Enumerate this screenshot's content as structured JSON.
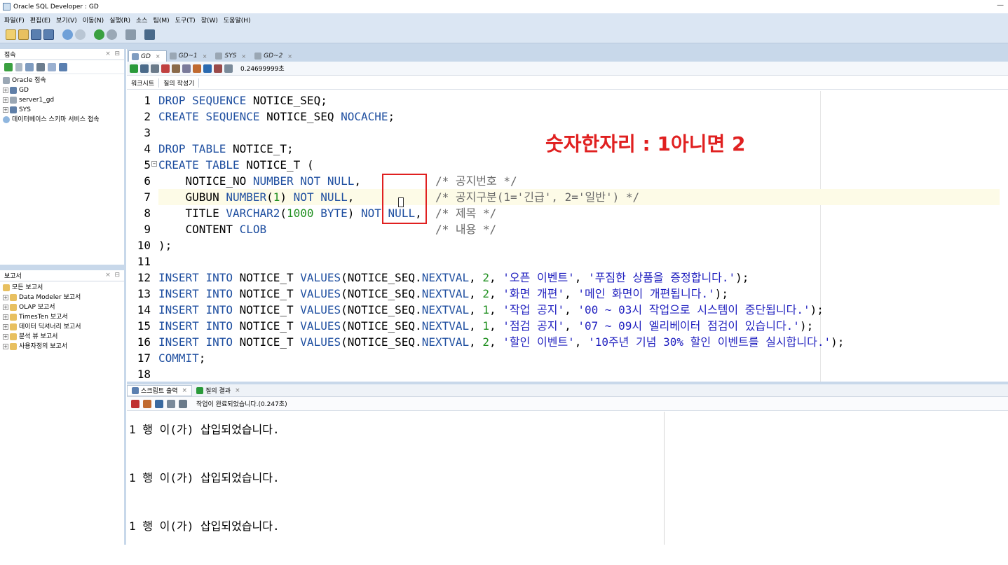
{
  "window": {
    "title": "Oracle SQL Developer : GD"
  },
  "menu": [
    "파일(F)",
    "편집(E)",
    "보기(V)",
    "이동(N)",
    "실행(R)",
    "소스",
    "팀(M)",
    "도구(T)",
    "창(W)",
    "도움말(H)"
  ],
  "connections_panel": {
    "title": "접속",
    "tree": [
      "Oracle 접속",
      "GD",
      "server1_gd",
      "SYS",
      "데이터베이스 스키마 서비스 접속"
    ]
  },
  "reports_panel": {
    "title": "보고서",
    "items": [
      "모든 보고서",
      "Data Modeler 보고서",
      "OLAP 보고서",
      "TimesTen 보고서",
      "데이터 딕셔너리 보고서",
      "분석 뷰 보고서",
      "사용자정의 보고서"
    ]
  },
  "editor_tabs": [
    "GD",
    "GD~1",
    "SYS",
    "GD~2"
  ],
  "editor_toolbar": {
    "timing": "0.24699999초"
  },
  "subtabs": [
    "워크시트",
    "질의 작성기"
  ],
  "annotation": "숫자한자리 : 1아니면 2",
  "code_lines": [
    "DROP SEQUENCE NOTICE_SEQ;",
    "CREATE SEQUENCE NOTICE_SEQ NOCACHE;",
    "",
    "DROP TABLE NOTICE_T;",
    "CREATE TABLE NOTICE_T (",
    "    NOTICE_NO NUMBER NOT NULL,           /* 공지번호 */",
    "    GUBUN NUMBER(1) NOT NULL,            /* 공지구분(1='긴급', 2='일반') */",
    "    TITLE VARCHAR2(1000 BYTE) NOT NULL,  /* 제목 */",
    "    CONTENT CLOB                         /* 내용 */",
    ");",
    "",
    "INSERT INTO NOTICE_T VALUES(NOTICE_SEQ.NEXTVAL, 2, '오픈 이벤트', '푸짐한 상품을 증정합니다.');",
    "INSERT INTO NOTICE_T VALUES(NOTICE_SEQ.NEXTVAL, 2, '화면 개편', '메인 화면이 개편됩니다.');",
    "INSERT INTO NOTICE_T VALUES(NOTICE_SEQ.NEXTVAL, 1, '작업 공지', '00 ~ 03시 작업으로 시스템이 중단됩니다.');",
    "INSERT INTO NOTICE_T VALUES(NOTICE_SEQ.NEXTVAL, 1, '점검 공지', '07 ~ 09시 엘리베이터 점검이 있습니다.');",
    "INSERT INTO NOTICE_T VALUES(NOTICE_SEQ.NEXTVAL, 2, '할인 이벤트', '10주년 기념 30% 할인 이벤트를 실시합니다.');",
    "COMMIT;",
    ""
  ],
  "output_tabs": [
    "스크립트 출력",
    "질의 결과"
  ],
  "output_status": "작업이 완료되었습니다.(0.247초)",
  "output_lines": [
    "1 행 이(가) 삽입되었습니다.",
    "1 행 이(가) 삽입되었습니다.",
    "1 행 이(가) 삽입되었습니다."
  ]
}
